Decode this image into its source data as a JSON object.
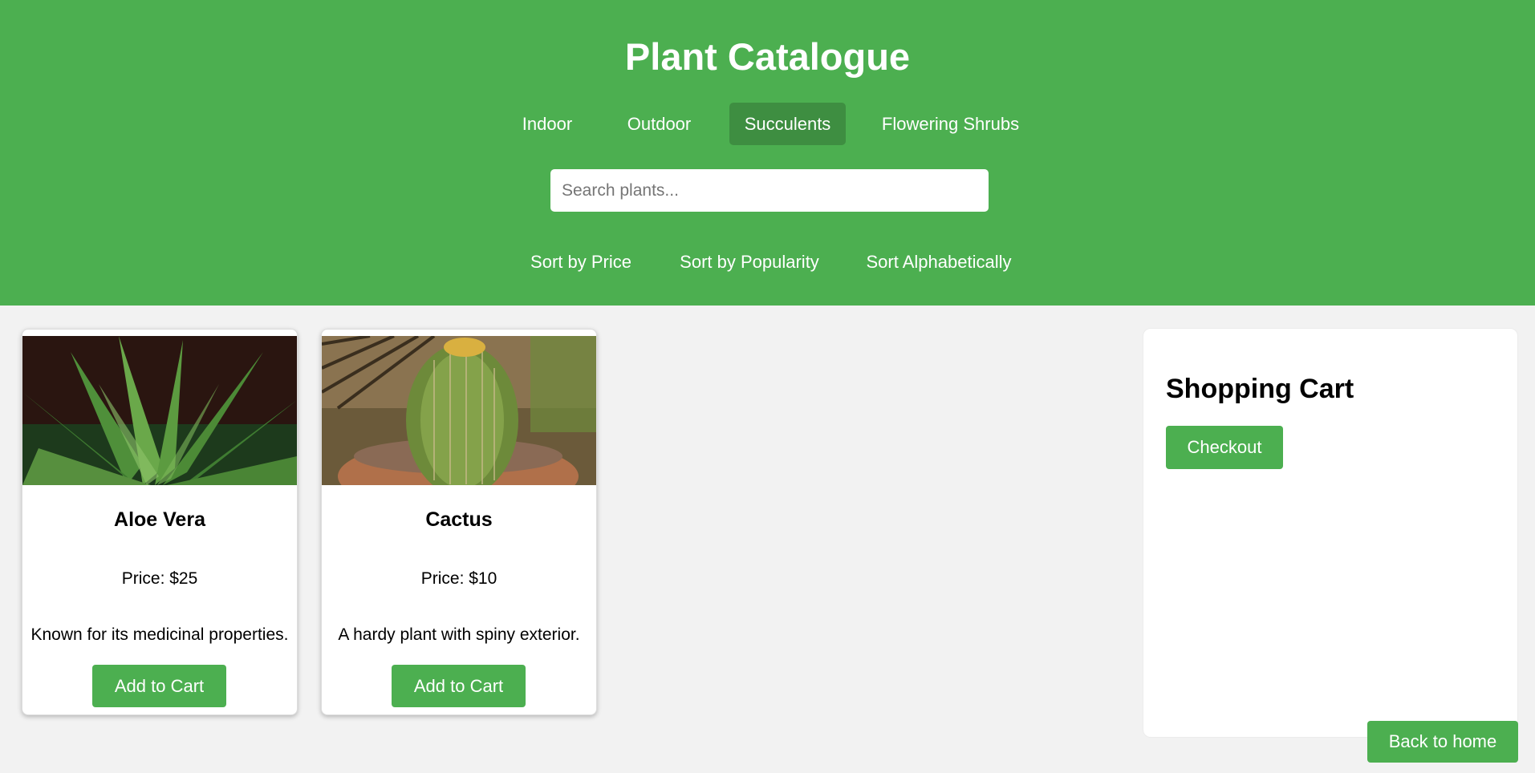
{
  "header": {
    "title": "Plant Catalogue",
    "categories": [
      {
        "label": "Indoor",
        "active": false
      },
      {
        "label": "Outdoor",
        "active": false
      },
      {
        "label": "Succulents",
        "active": true
      },
      {
        "label": "Flowering Shrubs",
        "active": false
      }
    ],
    "search": {
      "placeholder": "Search plants...",
      "value": ""
    },
    "sort": [
      {
        "label": "Sort by Price"
      },
      {
        "label": "Sort by Popularity"
      },
      {
        "label": "Sort Alphabetically"
      }
    ]
  },
  "products": [
    {
      "name": "Aloe Vera",
      "price": "Price: $25",
      "description": "Known for its medicinal properties.",
      "button": "Add to Cart",
      "image": "aloe-vera-photo"
    },
    {
      "name": "Cactus",
      "price": "Price: $10",
      "description": "A hardy plant with spiny exterior.",
      "button": "Add to Cart",
      "image": "cactus-photo"
    }
  ],
  "cart": {
    "title": "Shopping Cart",
    "checkout_label": "Checkout"
  },
  "footer": {
    "back_label": "Back to home"
  },
  "colors": {
    "primary": "#4caf50",
    "active_tab": "#3e8e41",
    "page_background": "#f2f2f2"
  }
}
